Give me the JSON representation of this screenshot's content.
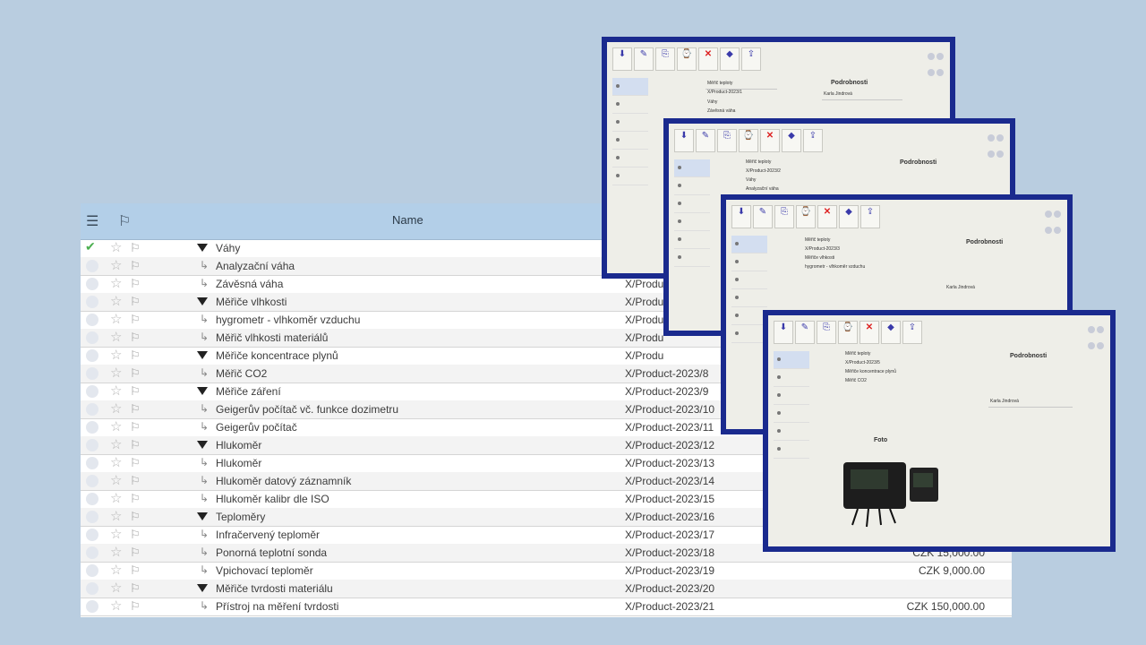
{
  "list": {
    "header_name": "Name",
    "rows": [
      {
        "type": "group",
        "checked": true,
        "name": "Váhy",
        "code": "",
        "price": ""
      },
      {
        "type": "item",
        "name": "Analyzační váha",
        "code": "",
        "price": ""
      },
      {
        "type": "item",
        "name": "Závěsná váha",
        "code": "X/Produ",
        "price": ""
      },
      {
        "type": "group",
        "name": "Měřiče vlhkosti",
        "code": "X/Produ",
        "price": ""
      },
      {
        "type": "item",
        "name": "hygrometr - vlhkoměr vzduchu",
        "code": "X/Produ",
        "price": ""
      },
      {
        "type": "item",
        "name": "Měřič vlhkosti materiálů",
        "code": "X/Produ",
        "price": ""
      },
      {
        "type": "group",
        "name": "Měřiče koncentrace plynů",
        "code": "X/Produ",
        "price": ""
      },
      {
        "type": "item",
        "name": "Měřič CO2",
        "code": "X/Product-2023/8",
        "price": ""
      },
      {
        "type": "group",
        "name": "Měřiče záření",
        "code": "X/Product-2023/9",
        "price": ""
      },
      {
        "type": "item",
        "name": "Geigerův počítač vč. funkce dozimetru",
        "code": "X/Product-2023/10",
        "price": ""
      },
      {
        "type": "item",
        "name": "Geigerův počítač",
        "code": "X/Product-2023/11",
        "price": ""
      },
      {
        "type": "group",
        "name": "Hlukoměr",
        "code": "X/Product-2023/12",
        "price": ""
      },
      {
        "type": "item",
        "name": "Hlukoměr",
        "code": "X/Product-2023/13",
        "price": ""
      },
      {
        "type": "item",
        "name": "Hlukoměr datový záznamník",
        "code": "X/Product-2023/14",
        "price": ""
      },
      {
        "type": "item",
        "name": "Hlukoměr kalibr dle ISO",
        "code": "X/Product-2023/15",
        "price": ""
      },
      {
        "type": "group",
        "name": "Teploměry",
        "code": "X/Product-2023/16",
        "price": ""
      },
      {
        "type": "item",
        "name": "Infračervený teploměr",
        "code": "X/Product-2023/17",
        "price": ""
      },
      {
        "type": "item",
        "name": "Ponorná teplotní sonda",
        "code": "X/Product-2023/18",
        "price": "CZK 15,000.00"
      },
      {
        "type": "item",
        "name": "Vpichovací teploměr",
        "code": "X/Product-2023/19",
        "price": "CZK 9,000.00"
      },
      {
        "type": "group",
        "name": "Měřiče tvrdosti materiálu",
        "code": "X/Product-2023/20",
        "price": ""
      },
      {
        "type": "item",
        "name": "Přístroj na měření tvrdosti",
        "code": "X/Product-2023/21",
        "price": "CZK 150,000.00"
      }
    ]
  },
  "windows": {
    "details_title": "Podrobnosti",
    "photo_title": "Foto",
    "w1": {
      "name": "Měřič teploty",
      "code": "X/Product-2023/1",
      "category": "Váhy",
      "desc": "Závěsná váha",
      "person": "Karla Jindrová"
    },
    "w2": {
      "name": "Měřič teploty",
      "code": "X/Product-2023/2",
      "category": "Váhy",
      "desc": "Analyzační váha",
      "person": ""
    },
    "w3": {
      "name": "Měřič teploty",
      "code": "X/Product-2023/3",
      "category": "Měřiče vlhkosti",
      "desc": "hygrometr - vlhkoměr vzduchu",
      "person": "Karla Jindrová"
    },
    "w4": {
      "name": "Měřič teploty",
      "code": "X/Product-2023/5",
      "category": "Měřiče koncentrace plynů",
      "desc": "Měřič CO2",
      "person": "Karla Jindrová"
    }
  }
}
